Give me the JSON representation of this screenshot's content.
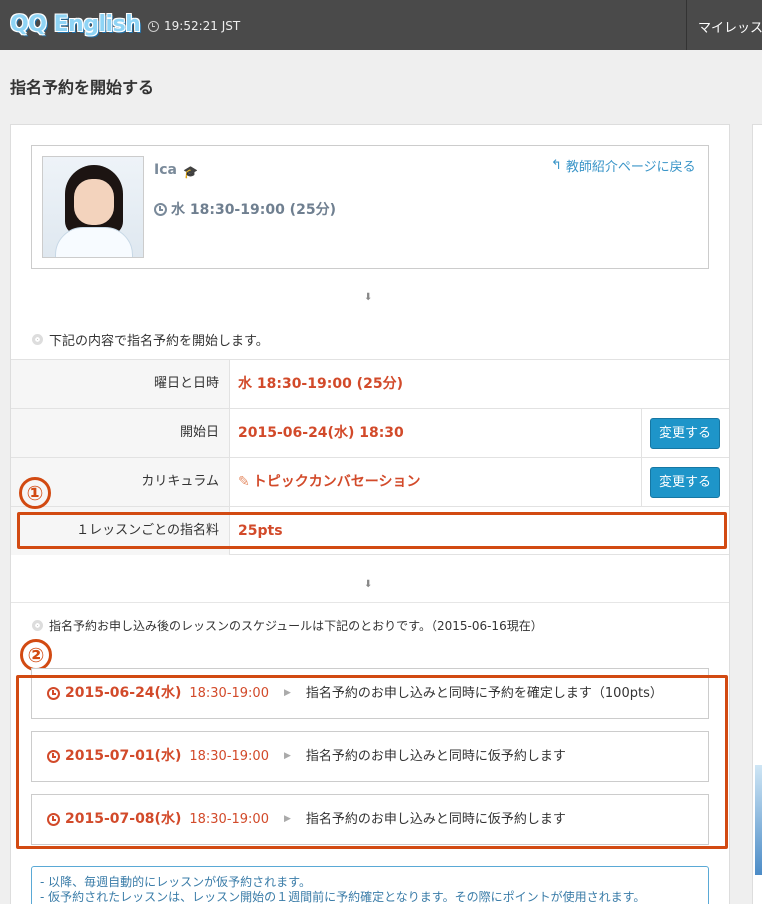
{
  "header": {
    "logo": "QQ English",
    "time": "19:52:21 JST",
    "my_lessons": "マイレッスン"
  },
  "page_title": "指名予約を開始する",
  "teacher": {
    "name": "Ica",
    "time": "水 18:30-19:00 (25分)",
    "back_link": "教師紹介ページに戻る"
  },
  "intro_text": "下記の内容で指名予約を開始します。",
  "details": [
    {
      "label": "曜日と日時",
      "value": "水 18:30-19:00 (25分)"
    },
    {
      "label": "開始日",
      "value": "2015-06-24(水) 18:30",
      "button": "変更する"
    },
    {
      "label": "カリキュラム",
      "value": "トピックカンバセーション",
      "button": "変更する"
    },
    {
      "label": "１レッスンごとの指名料",
      "value": "25pts"
    }
  ],
  "annotations": {
    "one": "①",
    "two": "②"
  },
  "schedule_intro": "指名予約お申し込み後のレッスンのスケジュールは下記のとおりです。（2015-06-16現在）",
  "schedule": [
    {
      "date": "2015-06-24(水)",
      "time": "18:30-19:00",
      "message": "指名予約のお申し込みと同時に予約を確定します（100pts）"
    },
    {
      "date": "2015-07-01(水)",
      "time": "18:30-19:00",
      "message": "指名予約のお申し込みと同時に仮予約します"
    },
    {
      "date": "2015-07-08(水)",
      "time": "18:30-19:00",
      "message": "指名予約のお申し込みと同時に仮予約します"
    }
  ],
  "notice": [
    "- 以降、毎週自動的にレッスンが仮予約されます。",
    "- 仮予約されたレッスンは、レッスン開始の１週間前に予約確定となります。その際にポイントが使用されます。"
  ]
}
